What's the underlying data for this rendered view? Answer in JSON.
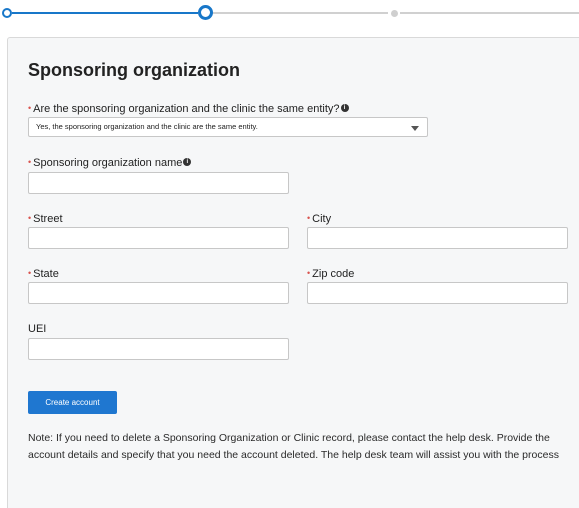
{
  "form": {
    "title": "Sponsoring organization",
    "same_entity": {
      "label": "Are the sponsoring organization and the clinic the same entity?",
      "value": "Yes, the sponsoring organization and the clinic are the same entity."
    },
    "org_name": {
      "label": "Sponsoring organization name"
    },
    "street": {
      "label": "Street"
    },
    "city": {
      "label": "City"
    },
    "state": {
      "label": "State"
    },
    "zip": {
      "label": "Zip code"
    },
    "uei": {
      "label": "UEI"
    },
    "submit_label": "Create account",
    "note": "Note: If you need to delete a Sponsoring Organization or Clinic record, please contact the help desk. Provide the account details and specify that you need the account deleted. The help desk team will assist you with the process"
  },
  "stepper": {
    "current_step": 2,
    "total_steps": 3
  },
  "colors": {
    "accent": "#1877c9",
    "button": "#1f77d0",
    "required": "#d9534f",
    "card_bg": "#f6f7f8"
  },
  "icons": {
    "info": "info-circle-icon",
    "caret": "chevron-down-icon"
  }
}
